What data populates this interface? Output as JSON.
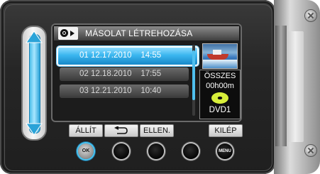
{
  "screen": {
    "title": "MÁSOLAT LÉTREHOZÁSA",
    "list": [
      {
        "index": "01",
        "date": "12.17.2010",
        "time": "14:55",
        "selected": true
      },
      {
        "index": "02",
        "date": "12.18.2010",
        "time": "17:55",
        "selected": false
      },
      {
        "index": "03",
        "date": "12.21.2010",
        "time": "10:40",
        "selected": false
      }
    ],
    "info": {
      "label": "ÖSSZES",
      "time": "00h00m",
      "disc_label": "DVD1"
    }
  },
  "soft_buttons": {
    "set_label": "ÁLLÍT",
    "back_icon": "return-arrow-icon",
    "check_label": "ELLEN.",
    "exit_label": "KILÉP"
  },
  "hw_buttons": {
    "ok_label": "OK",
    "menu_label": "MENU"
  },
  "colors": {
    "accent": "#3ab6ef",
    "dvd_disc": "#d7ee3a"
  }
}
